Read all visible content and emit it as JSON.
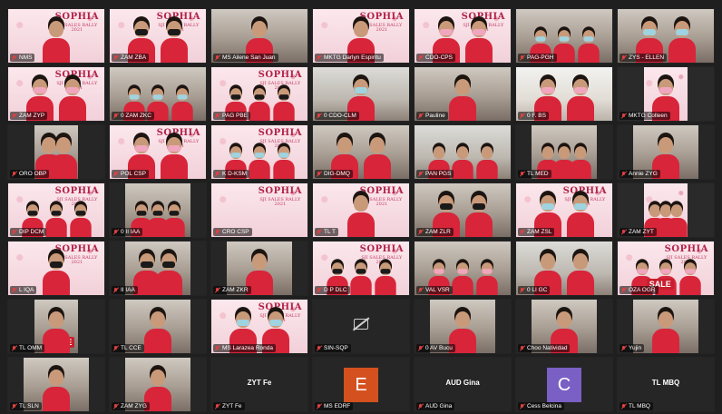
{
  "app": {
    "background": "#1f1f1f",
    "mic_color": "#e04040"
  },
  "banner": {
    "brand": "SOPHIA",
    "line1": "SJI SALES RALLY",
    "line2": "2021"
  },
  "tiles": [
    {
      "name": "NMS",
      "style": "banner",
      "people": 1,
      "mask": "none"
    },
    {
      "name": "ZAM ZBA",
      "style": "banner",
      "people": 2,
      "mask": "black"
    },
    {
      "name": "MS Ailene San Juan",
      "style": "room",
      "people": 1,
      "mask": "none"
    },
    {
      "name": "MKTG Darlyn Espiritu",
      "style": "banner",
      "people": 1,
      "mask": "none"
    },
    {
      "name": "CDO-CPS",
      "style": "banner",
      "people": 2,
      "mask": "pink"
    },
    {
      "name": "PAG-PGH",
      "style": "room",
      "people": 3,
      "mask": "blue"
    },
    {
      "name": "ZYS - ELLEN",
      "style": "room",
      "people": 2,
      "mask": "blue"
    },
    {
      "name": "ZAM ZYP",
      "style": "banner",
      "people": 2,
      "mask": "pink"
    },
    {
      "name": "0 ZAM ZKC",
      "style": "room",
      "people": 3,
      "mask": "blue"
    },
    {
      "name": "PAG PBE",
      "style": "banner",
      "people": 3,
      "mask": "black"
    },
    {
      "name": "0 CDO-CLM",
      "style": "office",
      "people": 1,
      "mask": "blue"
    },
    {
      "name": "Pauline",
      "style": "room",
      "people": 1,
      "mask": "none"
    },
    {
      "name": "0 F. BS",
      "style": "bright",
      "people": 2,
      "mask": "pink"
    },
    {
      "name": "MKTG Colleen",
      "style": "banner-narrow",
      "people": 1,
      "mask": "pink"
    },
    {
      "name": "ORO OBP",
      "style": "dark-narrow",
      "people": 2,
      "mask": "none"
    },
    {
      "name": "POL CSP",
      "style": "banner",
      "people": 2,
      "mask": "pink"
    },
    {
      "name": "K D-KSM",
      "style": "banner",
      "people": 3,
      "mask": "blue"
    },
    {
      "name": "DIG-DMQ",
      "style": "room",
      "people": 2,
      "mask": "none"
    },
    {
      "name": "PAN PGS",
      "style": "office",
      "people": 3,
      "mask": "none"
    },
    {
      "name": "TL MED",
      "style": "dark-mid",
      "people": 3,
      "mask": "none"
    },
    {
      "name": "Annie ZYG",
      "style": "dark-mid",
      "people": 1,
      "mask": "none"
    },
    {
      "name": "DIP DCM",
      "style": "banner",
      "people": 3,
      "mask": "black"
    },
    {
      "name": "0 II IAA",
      "style": "dark-mid",
      "people": 3,
      "mask": "black"
    },
    {
      "name": "CRO CSP",
      "style": "banner-empty",
      "people": 0,
      "mask": "none"
    },
    {
      "name": "TL T",
      "style": "banner",
      "people": 1,
      "mask": "none"
    },
    {
      "name": "ZAM ZLR",
      "style": "room",
      "people": 2,
      "mask": "black"
    },
    {
      "name": "ZAM ZSL",
      "style": "banner",
      "people": 2,
      "mask": "blue"
    },
    {
      "name": "ZAM ZYT",
      "style": "banner-narrow",
      "people": 3,
      "mask": "none"
    },
    {
      "name": "L IQA",
      "style": "banner",
      "people": 1,
      "mask": "black"
    },
    {
      "name": "II IAA",
      "style": "dark-mid",
      "people": 2,
      "mask": "black"
    },
    {
      "name": "ZAM ZKR",
      "style": "dark-mid",
      "people": 1,
      "mask": "none"
    },
    {
      "name": "D P DLC",
      "style": "banner",
      "people": 3,
      "mask": "black"
    },
    {
      "name": "VAL VSR",
      "style": "room",
      "people": 3,
      "mask": "pink"
    },
    {
      "name": "0 LI GC",
      "style": "office",
      "people": 2,
      "mask": "none"
    },
    {
      "name": "OZA OGR",
      "style": "banner-sale",
      "people": 3,
      "mask": "pink"
    },
    {
      "name": "TL OMM",
      "style": "dark-narrow-sale",
      "people": 1,
      "mask": "none"
    },
    {
      "name": "TL CCE",
      "style": "dark-mid",
      "people": 1,
      "mask": "none"
    },
    {
      "name": "MS Larazea Ronda",
      "style": "banner",
      "people": 2,
      "mask": "blue"
    },
    {
      "name": "SIN-SQP",
      "style": "camoff",
      "people": 0,
      "mask": "none"
    },
    {
      "name": "0 AV Bucu",
      "style": "dark-mid",
      "people": 1,
      "mask": "none"
    },
    {
      "name": "Choo Natividad",
      "style": "dark-mid",
      "people": 1,
      "mask": "none"
    },
    {
      "name": "Yujin",
      "style": "dark-mid",
      "people": 1,
      "mask": "none"
    },
    {
      "name": "TL SLN",
      "style": "dark-mid",
      "people": 1,
      "mask": "none"
    },
    {
      "name": "ZAM ZYG",
      "style": "dark-mid",
      "people": 1,
      "mask": "none"
    },
    {
      "name": "ZYT Fe",
      "style": "name-only",
      "center": "ZYT Fe",
      "people": 0,
      "mask": "none"
    },
    {
      "name": "MS EDRF",
      "style": "avatar",
      "avatar_letter": "E",
      "avatar_color": "#d4511f",
      "people": 0,
      "mask": "none"
    },
    {
      "name": "AUD Gina",
      "style": "name-only",
      "center": "AUD Gina",
      "people": 0,
      "mask": "none"
    },
    {
      "name": "Cess Belcina",
      "style": "avatar",
      "avatar_letter": "C",
      "avatar_color": "#7a5fc4",
      "people": 0,
      "mask": "none"
    },
    {
      "name": "TL MBQ",
      "style": "name-only",
      "center": "TL MBQ",
      "people": 0,
      "mask": "none"
    }
  ]
}
